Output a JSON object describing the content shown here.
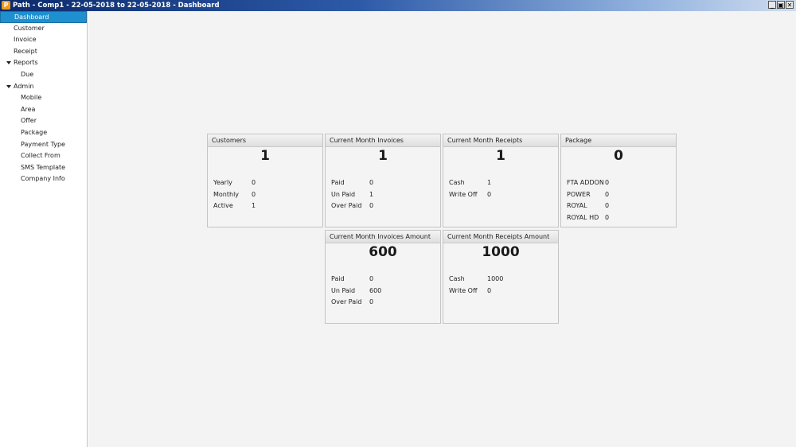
{
  "window": {
    "title": "Path - Comp1 - 22-05-2018 to 22-05-2018 - Dashboard",
    "icon_letter": "P",
    "buttons": {
      "minimize": "_",
      "restore": "▣",
      "close": "✕"
    }
  },
  "sidebar": {
    "items": [
      {
        "label": "Dashboard"
      },
      {
        "label": "Customer"
      },
      {
        "label": "Invoice"
      },
      {
        "label": "Receipt"
      },
      {
        "label": "Reports"
      },
      {
        "label": "Due"
      },
      {
        "label": "Admin"
      },
      {
        "label": "Mobile"
      },
      {
        "label": "Area"
      },
      {
        "label": "Offer"
      },
      {
        "label": "Package"
      },
      {
        "label": "Payment Type"
      },
      {
        "label": "Collect From"
      },
      {
        "label": "SMS Template"
      },
      {
        "label": "Company Info"
      }
    ]
  },
  "cards": [
    {
      "title": "Customers",
      "value": "1",
      "rows": [
        {
          "k": "Yearly",
          "v": "0"
        },
        {
          "k": "Monthly",
          "v": "0"
        },
        {
          "k": "Active",
          "v": "1"
        }
      ]
    },
    {
      "title": "Current Month Invoices",
      "value": "1",
      "rows": [
        {
          "k": "Paid",
          "v": "0"
        },
        {
          "k": "Un Paid",
          "v": "1"
        },
        {
          "k": "Over Paid",
          "v": "0"
        }
      ]
    },
    {
      "title": "Current Month Receipts",
      "value": "1",
      "rows": [
        {
          "k": "Cash",
          "v": "1"
        },
        {
          "k": "Write Off",
          "v": "0"
        }
      ]
    },
    {
      "title": "Package",
      "value": "0",
      "rows": [
        {
          "k": "FTA ADDON",
          "v": "0"
        },
        {
          "k": "POWER",
          "v": "0"
        },
        {
          "k": "ROYAL",
          "v": "0"
        },
        {
          "k": "ROYAL HD",
          "v": "0"
        }
      ]
    },
    {
      "title": "Current Month Invoices Amount",
      "value": "600",
      "rows": [
        {
          "k": "Paid",
          "v": "0"
        },
        {
          "k": "Un Paid",
          "v": "600"
        },
        {
          "k": "Over Paid",
          "v": "0"
        }
      ]
    },
    {
      "title": "Current Month Receipts Amount",
      "value": "1000",
      "rows": [
        {
          "k": "Cash",
          "v": "1000"
        },
        {
          "k": "Write Off",
          "v": "0"
        }
      ]
    }
  ]
}
